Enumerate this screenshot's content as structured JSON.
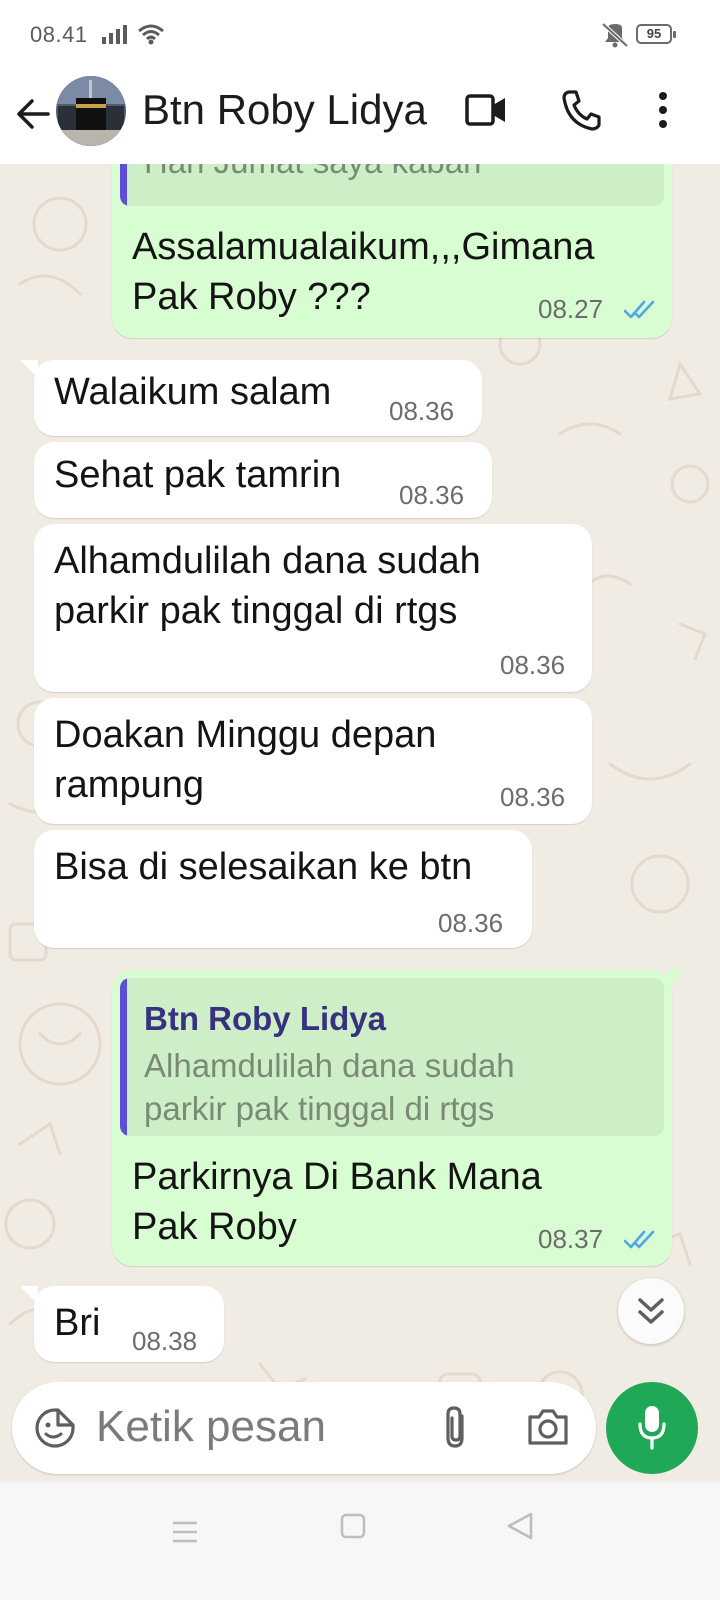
{
  "status": {
    "time": "08.41",
    "battery": "95"
  },
  "header": {
    "title": "Btn Roby Lidya"
  },
  "messages": [
    {
      "dir": "out",
      "quote_text": "Hari Jumat saya kabari",
      "text": "Assalamualaikum,,,Gimana\nPak Roby ???",
      "time": "08.27",
      "read": true
    },
    {
      "dir": "in",
      "text": "Walaikum salam",
      "time": "08.36"
    },
    {
      "dir": "in",
      "text": "Sehat pak tamrin",
      "time": "08.36"
    },
    {
      "dir": "in",
      "text": "Alhamdulilah dana sudah\nparkir pak tinggal di rtgs",
      "time": "08.36"
    },
    {
      "dir": "in",
      "text": "Doakan Minggu depan\nrampung",
      "time": "08.36"
    },
    {
      "dir": "in",
      "text": "Bisa di selesaikan ke btn",
      "time": "08.36"
    },
    {
      "dir": "out",
      "quote_name": "Btn Roby Lidya",
      "quote_text": "Alhamdulilah dana sudah\nparkir pak tinggal di rtgs",
      "text": "Parkirnya Di Bank Mana\nPak Roby",
      "time": "08.37",
      "read": true
    },
    {
      "dir": "in",
      "text": "Bri",
      "time": "08.38"
    }
  ],
  "composer": {
    "placeholder": "Ketik pesan"
  },
  "colors": {
    "outgoing_bubble": "#d8fdd2",
    "incoming_bubble": "#ffffff",
    "wallpaper": "#f0ebe3",
    "accent_green": "#1fa855",
    "read_tick_blue": "#4fa6e8",
    "quote_bar": "#5d4fd5"
  },
  "icons": [
    "back-arrow-icon",
    "video-call-icon",
    "phone-call-icon",
    "more-menu-icon",
    "double-chevron-down-icon",
    "emoji-icon",
    "paperclip-icon",
    "camera-icon",
    "microphone-icon"
  ]
}
